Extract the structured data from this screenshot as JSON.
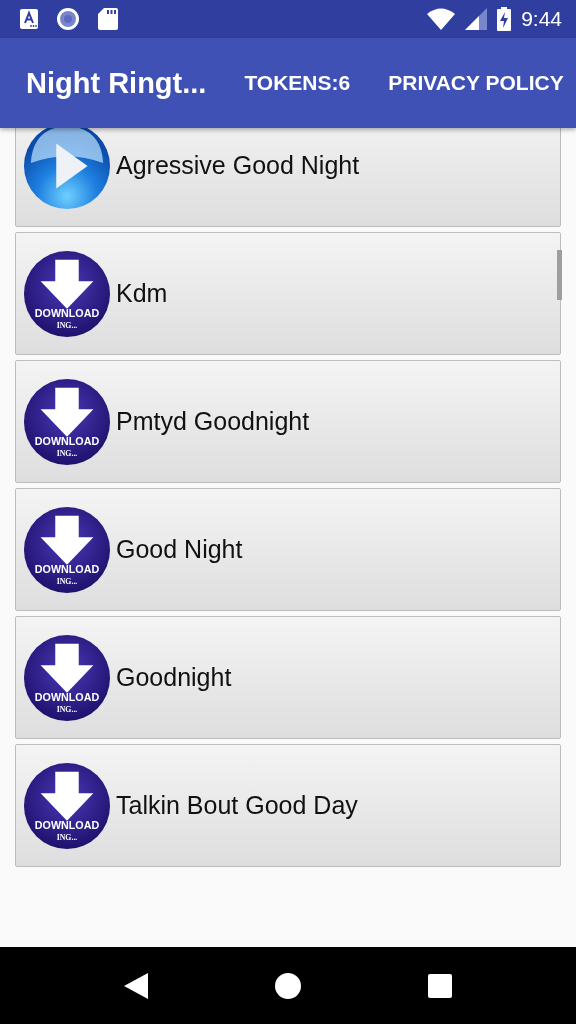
{
  "status_bar": {
    "time": "9:44"
  },
  "app_bar": {
    "title": "Night Ringt...",
    "actions": [
      {
        "label": "TOKENS:6"
      },
      {
        "label": "PRIVACY POLICY"
      }
    ]
  },
  "ringtones": [
    {
      "kind": "play",
      "title": "Agressive Good Night"
    },
    {
      "kind": "download",
      "title": "Kdm",
      "icon_caption": "DOWNLOAD",
      "icon_subcaption": "ING..."
    },
    {
      "kind": "download",
      "title": "Pmtyd Goodnight",
      "icon_caption": "DOWNLOAD",
      "icon_subcaption": "ING..."
    },
    {
      "kind": "download",
      "title": "Good Night",
      "icon_caption": "DOWNLOAD",
      "icon_subcaption": "ING..."
    },
    {
      "kind": "download",
      "title": "Goodnight",
      "icon_caption": "DOWNLOAD",
      "icon_subcaption": "ING..."
    },
    {
      "kind": "download",
      "title": "Talkin Bout Good Day",
      "icon_caption": "DOWNLOAD",
      "icon_subcaption": "ING..."
    }
  ]
}
